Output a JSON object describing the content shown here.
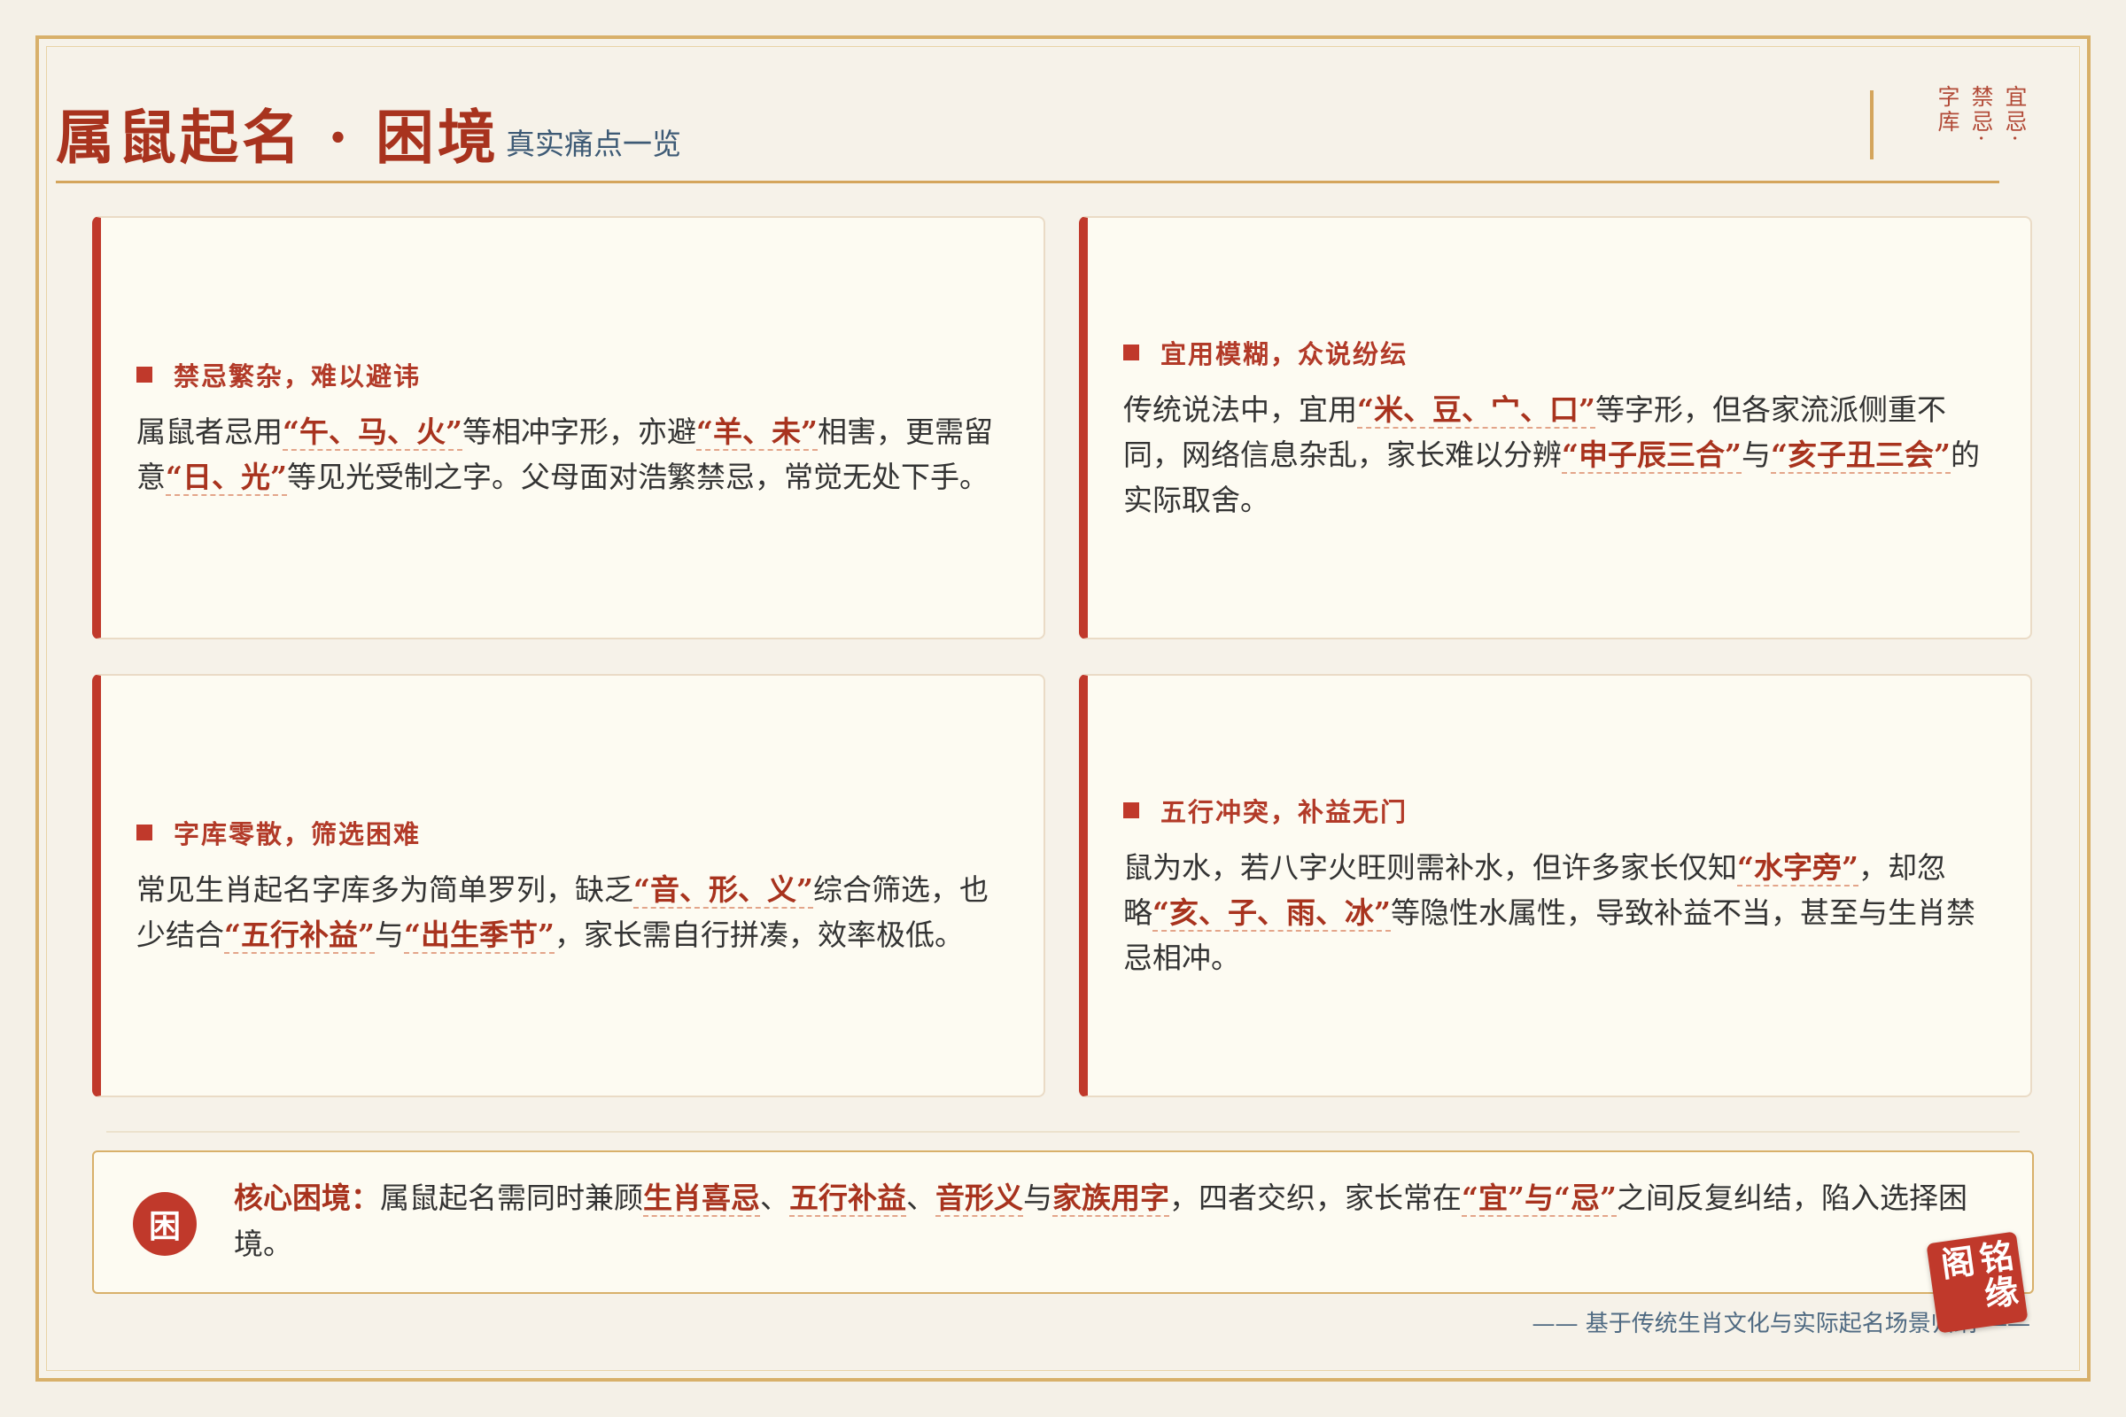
{
  "header": {
    "title": "属鼠起名 · 困境",
    "subtitle": "真实痛点一览",
    "stamp": "宜忌·禁忌·字库"
  },
  "cards": [
    {
      "title": "禁忌繁杂，难以避讳",
      "body": [
        {
          "t": "属鼠者忌用"
        },
        {
          "t": "“午、马、火”",
          "hl": true
        },
        {
          "t": "等相冲字形，亦避"
        },
        {
          "t": "“羊、未”",
          "hl": true
        },
        {
          "t": "相害，更需留意"
        },
        {
          "t": "“日、光”",
          "hl": true
        },
        {
          "t": "等见光受制之字。父母面对浩繁禁忌，常觉无处下手。"
        }
      ]
    },
    {
      "title": "宜用模糊，众说纷纭",
      "body": [
        {
          "t": "传统说法中，宜用"
        },
        {
          "t": "“米、豆、宀、口”",
          "hl": true
        },
        {
          "t": "等字形，但各家流派侧重不同，网络信息杂乱，家长难以分辨"
        },
        {
          "t": "“申子辰三合”",
          "hl": true
        },
        {
          "t": "与"
        },
        {
          "t": "“亥子丑三会”",
          "hl": true
        },
        {
          "t": "的实际取舍。"
        }
      ]
    },
    {
      "title": "字库零散，筛选困难",
      "body": [
        {
          "t": "常见生肖起名字库多为简单罗列，缺乏"
        },
        {
          "t": "“音、形、义”",
          "hl": true
        },
        {
          "t": "综合筛选，也少结合"
        },
        {
          "t": "“五行补益”",
          "hl": true
        },
        {
          "t": "与"
        },
        {
          "t": "“出生季节”",
          "hl": true
        },
        {
          "t": "，家长需自行拼凑，效率极低。"
        }
      ]
    },
    {
      "title": "五行冲突，补益无门",
      "body": [
        {
          "t": "鼠为水，若八字火旺则需补水，但许多家长仅知"
        },
        {
          "t": "“水字旁”",
          "hl": true
        },
        {
          "t": "，却忽略"
        },
        {
          "t": "“亥、子、雨、冰”",
          "hl": true
        },
        {
          "t": "等隐性水属性，导致补益不当，甚至与生肖禁忌相冲。"
        }
      ]
    }
  ],
  "core": {
    "badge": "困",
    "label": "核心困境：",
    "body": [
      {
        "t": "属鼠起名需同时兼顾"
      },
      {
        "t": "生肖喜忌",
        "hl": true
      },
      {
        "t": "、"
      },
      {
        "t": "五行补益",
        "hl": true
      },
      {
        "t": "、"
      },
      {
        "t": "音形义",
        "hl": true
      },
      {
        "t": "与"
      },
      {
        "t": "家族用字",
        "hl": true
      },
      {
        "t": "，四者交织，家长常在"
      },
      {
        "t": "“宜”与“忌”",
        "hl": true
      },
      {
        "t": "之间反复纠结，陷入选择困境。"
      }
    ]
  },
  "footer": "—— 基于传统生肖文化与实际起名场景归纳 ——",
  "seal": "铭缘阁",
  "colors": {
    "accent": "#c0392b",
    "gold": "#d8b06a",
    "title": "#a8331e",
    "subtitle": "#3d5a75",
    "card_bg": "#fdfbf2",
    "page_bg": "#f4f0e7"
  }
}
